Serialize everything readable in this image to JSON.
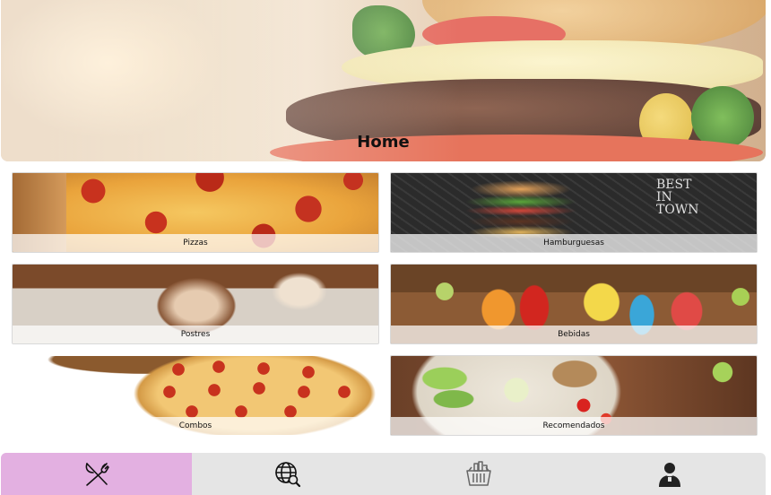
{
  "header": {
    "title": "Home"
  },
  "categories": [
    {
      "label": "Pizzas",
      "image": "pizza-photo"
    },
    {
      "label": "Hamburguesas",
      "image": "burger-chalkboard-photo"
    },
    {
      "label": "Postres",
      "image": "dessert-glass-photo"
    },
    {
      "label": "Bebidas",
      "image": "cocktails-photo"
    },
    {
      "label": "Combos",
      "image": "pepperoni-pizza-photo"
    },
    {
      "label": "Recomendados",
      "image": "salad-bowl-photo"
    }
  ],
  "bottom_nav": {
    "items": [
      {
        "icon": "fork-knife-icon",
        "active": true
      },
      {
        "icon": "globe-search-icon",
        "active": false
      },
      {
        "icon": "basket-icon",
        "active": false
      },
      {
        "icon": "user-icon",
        "active": false
      }
    ],
    "active_color": "#e3b0e1",
    "background_color": "#e5e5e5"
  }
}
